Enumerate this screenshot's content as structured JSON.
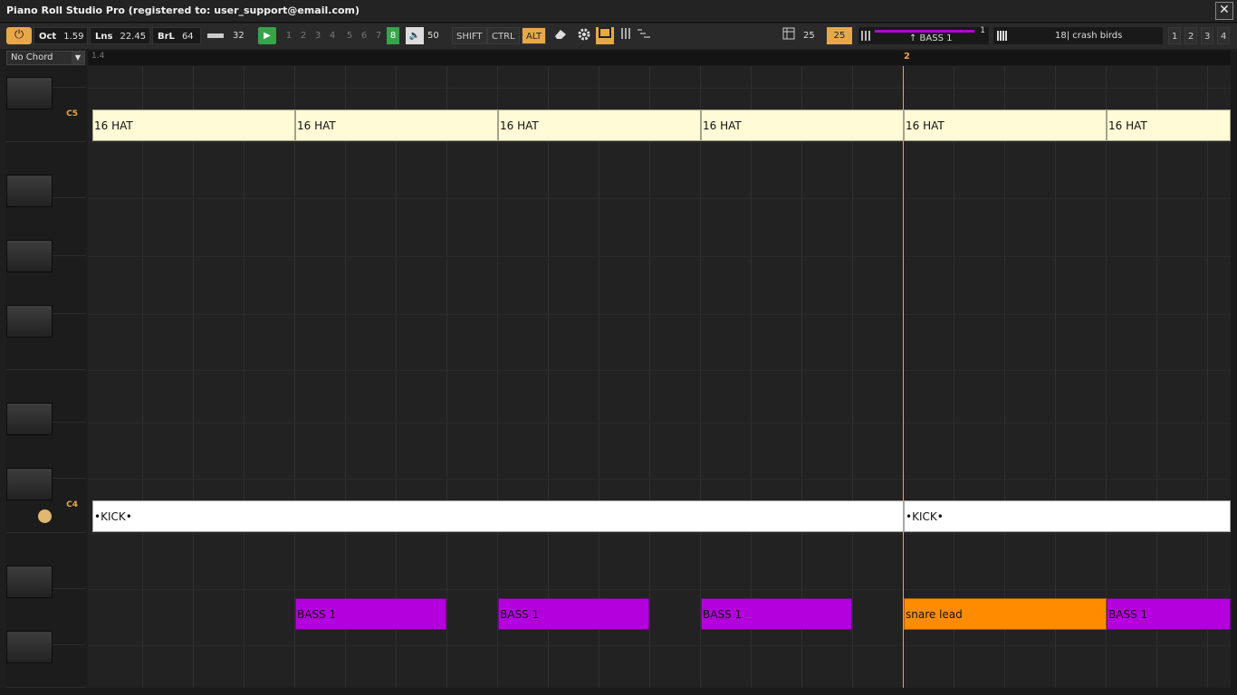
{
  "window": {
    "title": "Piano Roll Studio Pro  (registered to: user_support@email.com)",
    "close_glyph": "✕"
  },
  "toolbar": {
    "power_glyph": "⏻",
    "oct_label": "Oct",
    "oct_value": "1.59",
    "lns_label": "Lns",
    "lns_value": "22.45",
    "brl_label": "BrL",
    "brl_value": "64",
    "length_value": "32",
    "play_glyph": "▶",
    "numbers": [
      "1",
      "2",
      "3",
      "4",
      "5",
      "6",
      "7",
      "8"
    ],
    "active_number": "8",
    "volume_glyph": "🔈",
    "volume_value": "50",
    "shift": "SHIFT",
    "ctrl": "CTRL",
    "alt": "ALT",
    "snap_value_a": "25",
    "snap_value_b": "25",
    "channel_number": "1",
    "channel_name": "↑ BASS 1",
    "pattern_name": "18| crash birds",
    "views": [
      "1",
      "2",
      "3",
      "4"
    ]
  },
  "chord_select": {
    "value": "No Chord"
  },
  "ruler": {
    "left_label": "1.4",
    "bar_label": "2"
  },
  "keyboard": {
    "c5": "C5",
    "c4": "C4"
  },
  "notes": {
    "hat": "16 HAT",
    "kick": "•KICK•",
    "bass": "BASS 1",
    "snare": "snare lead"
  },
  "colors": {
    "accent": "#e8a84a",
    "hat": "#fffbd6",
    "kick": "#ffffff",
    "bass": "#b400dc",
    "snare": "#ff8c00",
    "play": "#36a54a"
  }
}
